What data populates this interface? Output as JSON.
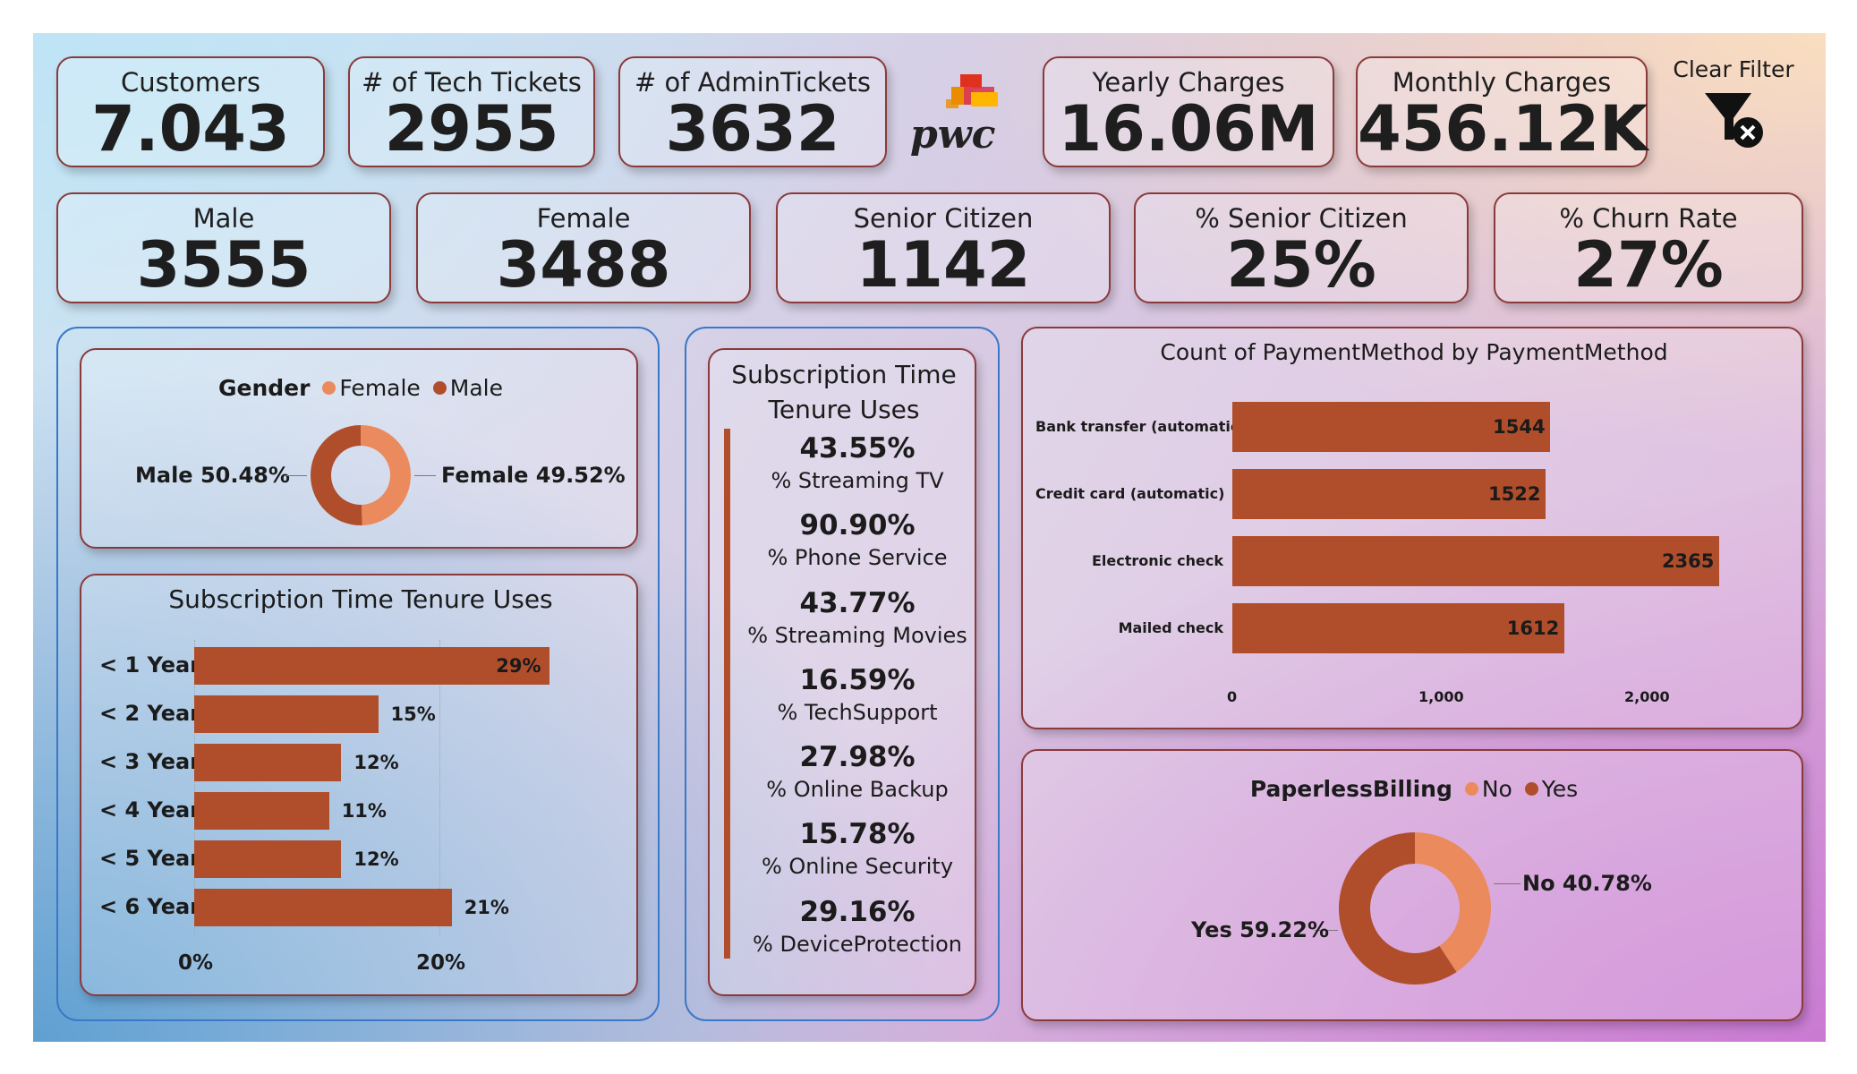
{
  "kpis_top": [
    {
      "label": "Customers",
      "value": "7.043"
    },
    {
      "label": "# of Tech Tickets",
      "value": "2955"
    },
    {
      "label": "# of AdminTickets",
      "value": "3632"
    },
    {
      "label": "Yearly Charges",
      "value": "16.06M"
    },
    {
      "label": "Monthly Charges",
      "value": "456.12K"
    }
  ],
  "kpis_bottom": [
    {
      "label": "Male",
      "value": "3555"
    },
    {
      "label": "Female",
      "value": "3488"
    },
    {
      "label": "Senior Citizen",
      "value": "1142"
    },
    {
      "label": "% Senior Citizen",
      "value": "25%"
    },
    {
      "label": "% Churn Rate",
      "value": "27%"
    }
  ],
  "logo": {
    "text": "pwc"
  },
  "clear_filter": {
    "label": "Clear Filter",
    "icon": "filter-clear-icon"
  },
  "colors": {
    "accent": "#b04e2b",
    "light": "#eb8a5c",
    "border": "#8a3a3a",
    "group_border": "#3a78c8"
  },
  "chart_data": [
    {
      "type": "pie",
      "title": "Gender",
      "legend": [
        "Female",
        "Male"
      ],
      "slices": [
        {
          "name": "Male",
          "value": 50.48,
          "label": "Male 50.48%"
        },
        {
          "name": "Female",
          "value": 49.52,
          "label": "Female 49.52%"
        }
      ]
    },
    {
      "type": "bar",
      "orientation": "horizontal",
      "title": "Subscription Time Tenure Uses",
      "categories": [
        "< 1 Year",
        "< 2 Year",
        "< 3 Year",
        "< 4 Year",
        "< 5 Year",
        "< 6 Year"
      ],
      "values": [
        29,
        15,
        12,
        11,
        12,
        21
      ],
      "value_labels": [
        "29%",
        "15%",
        "12%",
        "11%",
        "12%",
        "21%"
      ],
      "xlim": [
        0,
        20
      ],
      "ticks": [
        "0%",
        "20%"
      ]
    },
    {
      "type": "bar",
      "orientation": "horizontal",
      "title": "Count of PaymentMethod by PaymentMethod",
      "categories": [
        "Bank transfer (automatic)",
        "Credit card (automatic)",
        "Electronic check",
        "Mailed check"
      ],
      "values": [
        1544,
        1522,
        2365,
        1612
      ],
      "value_labels": [
        "1544",
        "1522",
        "2365",
        "1612"
      ],
      "xlim": [
        0,
        2000
      ],
      "ticks": [
        "0",
        "1,000",
        "2,000"
      ]
    },
    {
      "type": "pie",
      "title": "PaperlessBilling",
      "legend": [
        "No",
        "Yes"
      ],
      "slices": [
        {
          "name": "No",
          "value": 40.78,
          "label": "No 40.78%"
        },
        {
          "name": "Yes",
          "value": 59.22,
          "label": "Yes 59.22%"
        }
      ]
    }
  ],
  "services": {
    "title_line1": "Subscription Time",
    "title_line2": "Tenure Uses",
    "items": [
      {
        "value": "43.55%",
        "label": "% Streaming TV"
      },
      {
        "value": "90.90%",
        "label": "% Phone Service"
      },
      {
        "value": "43.77%",
        "label": "% Streaming Movies"
      },
      {
        "value": "16.59%",
        "label": "% TechSupport"
      },
      {
        "value": "27.98%",
        "label": "% Online Backup"
      },
      {
        "value": "15.78%",
        "label": "% Online Security"
      },
      {
        "value": "29.16%",
        "label": "% DeviceProtection"
      }
    ]
  }
}
